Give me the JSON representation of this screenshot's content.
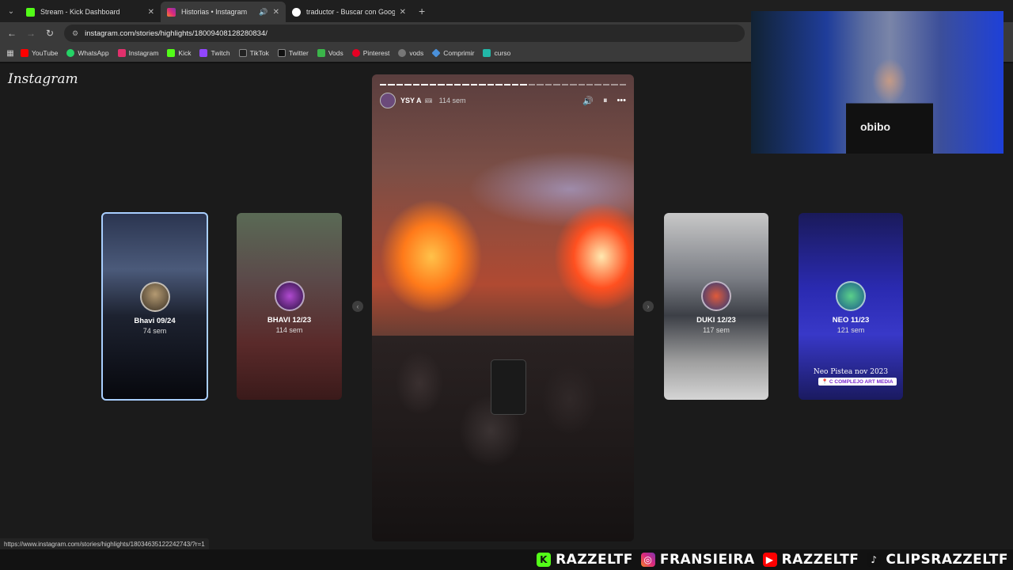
{
  "tabs": [
    {
      "label": "Stream - Kick Dashboard",
      "active": false,
      "favicon_color": "#53fc18",
      "favicon_icon": "kick-icon"
    },
    {
      "label": "Historias • Instagram",
      "active": true,
      "favicon_color": "#e1306c",
      "favicon_icon": "instagram-icon"
    },
    {
      "label": "traductor - Buscar con Google",
      "active": false,
      "favicon_color": "#ffffff",
      "favicon_icon": "google-icon"
    }
  ],
  "address_bar": {
    "url": "instagram.com/stories/highlights/18009408128280834/"
  },
  "bookmarks": [
    {
      "label": "YouTube",
      "color": "#ff0000"
    },
    {
      "label": "WhatsApp",
      "color": "#25d366"
    },
    {
      "label": "Instagram",
      "color": "#e1306c"
    },
    {
      "label": "Kick",
      "color": "#53fc18"
    },
    {
      "label": "Twitch",
      "color": "#9146ff"
    },
    {
      "label": "TikTok",
      "color": "#222222"
    },
    {
      "label": "Twitter",
      "color": "#111111"
    },
    {
      "label": "Vods",
      "color": "#3bb54a"
    },
    {
      "label": "Pinterest",
      "color": "#e60023"
    },
    {
      "label": "vods",
      "color": "#777777"
    },
    {
      "label": "Comprimir",
      "color": "#4a90d9"
    },
    {
      "label": "curso",
      "color": "#22b8a8"
    }
  ],
  "instagram": {
    "logo": "Instagram",
    "main_story": {
      "username": "YSY A",
      "time": "114 sem",
      "segments_total": 30,
      "segments_done": 18
    },
    "highlights": [
      {
        "name": "Bhavi 09/24",
        "time": "74 sem",
        "selected": true
      },
      {
        "name": "BHAVI 12/23",
        "time": "114 sem",
        "selected": false
      },
      {
        "name": "DUKI 12/23",
        "time": "117 sem",
        "selected": false
      },
      {
        "name": "NEO 11/23",
        "time": "121 sem",
        "selected": false,
        "caption": "Neo Pistea nov 2023",
        "location": "C COMPLEJO ART MEDIA"
      }
    ]
  },
  "status_url": "https://www.instagram.com/stories/highlights/18034635122242743/?r=1",
  "overlay": [
    {
      "handle": "RAZZELTF",
      "icon": "kick-icon",
      "color": "#53fc18"
    },
    {
      "handle": "FRANSIEIRA",
      "icon": "instagram-icon",
      "color": "#e1306c"
    },
    {
      "handle": "RAZZELTF",
      "icon": "youtube-icon",
      "color": "#ff0000"
    },
    {
      "handle": "CLIPSRAZZELTF",
      "icon": "tiktok-icon",
      "color": "#111111"
    }
  ],
  "webcam": {
    "shirt_text": "obibo"
  }
}
